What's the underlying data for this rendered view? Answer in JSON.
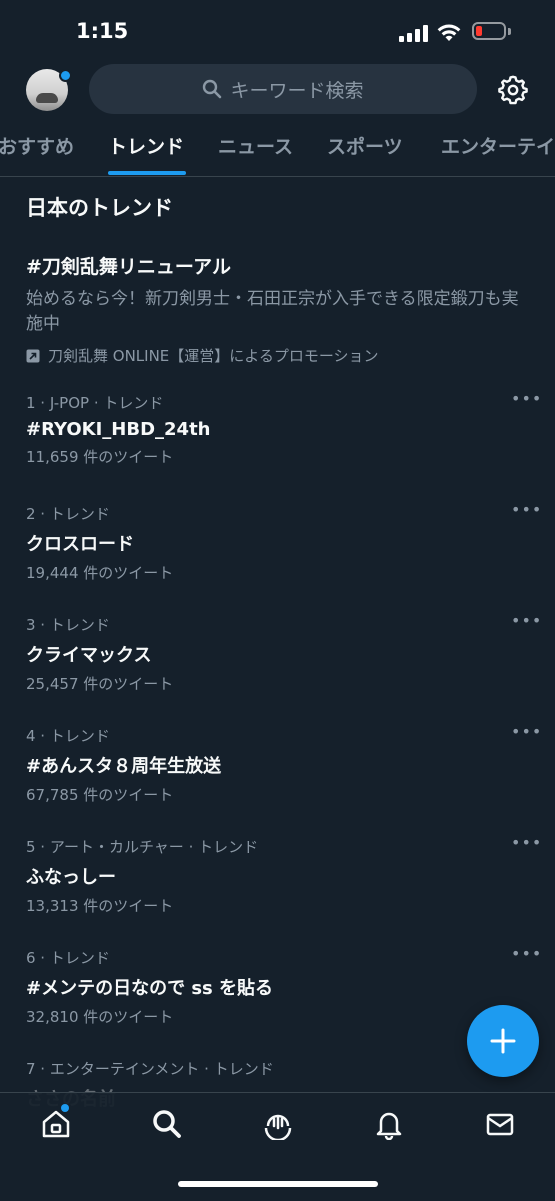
{
  "status_bar": {
    "time": "1:15"
  },
  "header": {
    "search_placeholder": "キーワード検索"
  },
  "tabs": [
    {
      "label": "おすすめ"
    },
    {
      "label": "トレンド"
    },
    {
      "label": "ニュース"
    },
    {
      "label": "スポーツ"
    },
    {
      "label": "エンターテイ"
    }
  ],
  "section_title": "日本のトレンド",
  "promo": {
    "title": "#刀剣乱舞リニューアル",
    "description": "始めるなら今！新刀剣男士・石田正宗が入手できる限定鍛刀も実施中",
    "promoted_by": "刀剣乱舞 ONLINE【運営】によるプロモーション"
  },
  "trends": [
    {
      "meta": "1 · J-POP · トレンド",
      "title": "#RYOKI_HBD_24th",
      "count": "11,659 件のツイート"
    },
    {
      "meta": "2 · トレンド",
      "title": "クロスロード",
      "count": "19,444 件のツイート"
    },
    {
      "meta": "3 · トレンド",
      "title": "クライマックス",
      "count": "25,457 件のツイート"
    },
    {
      "meta": "4 · トレンド",
      "title": "#あんスタ８周年生放送",
      "count": "67,785 件のツイート"
    },
    {
      "meta": "5 · アート・カルチャー · トレンド",
      "title": "ふなっしー",
      "count": "13,313 件のツイート"
    },
    {
      "meta": "6 · トレンド",
      "title": "#メンテの日なので ss を貼る",
      "count": "32,810 件のツイート"
    },
    {
      "meta": "7 · エンターテインメント · トレンド",
      "title": "ささの名前",
      "count": ""
    }
  ],
  "more_glyph": "•••",
  "colors": {
    "accent": "#1d9bf0",
    "background": "#15202b",
    "muted": "#8b98a5"
  }
}
